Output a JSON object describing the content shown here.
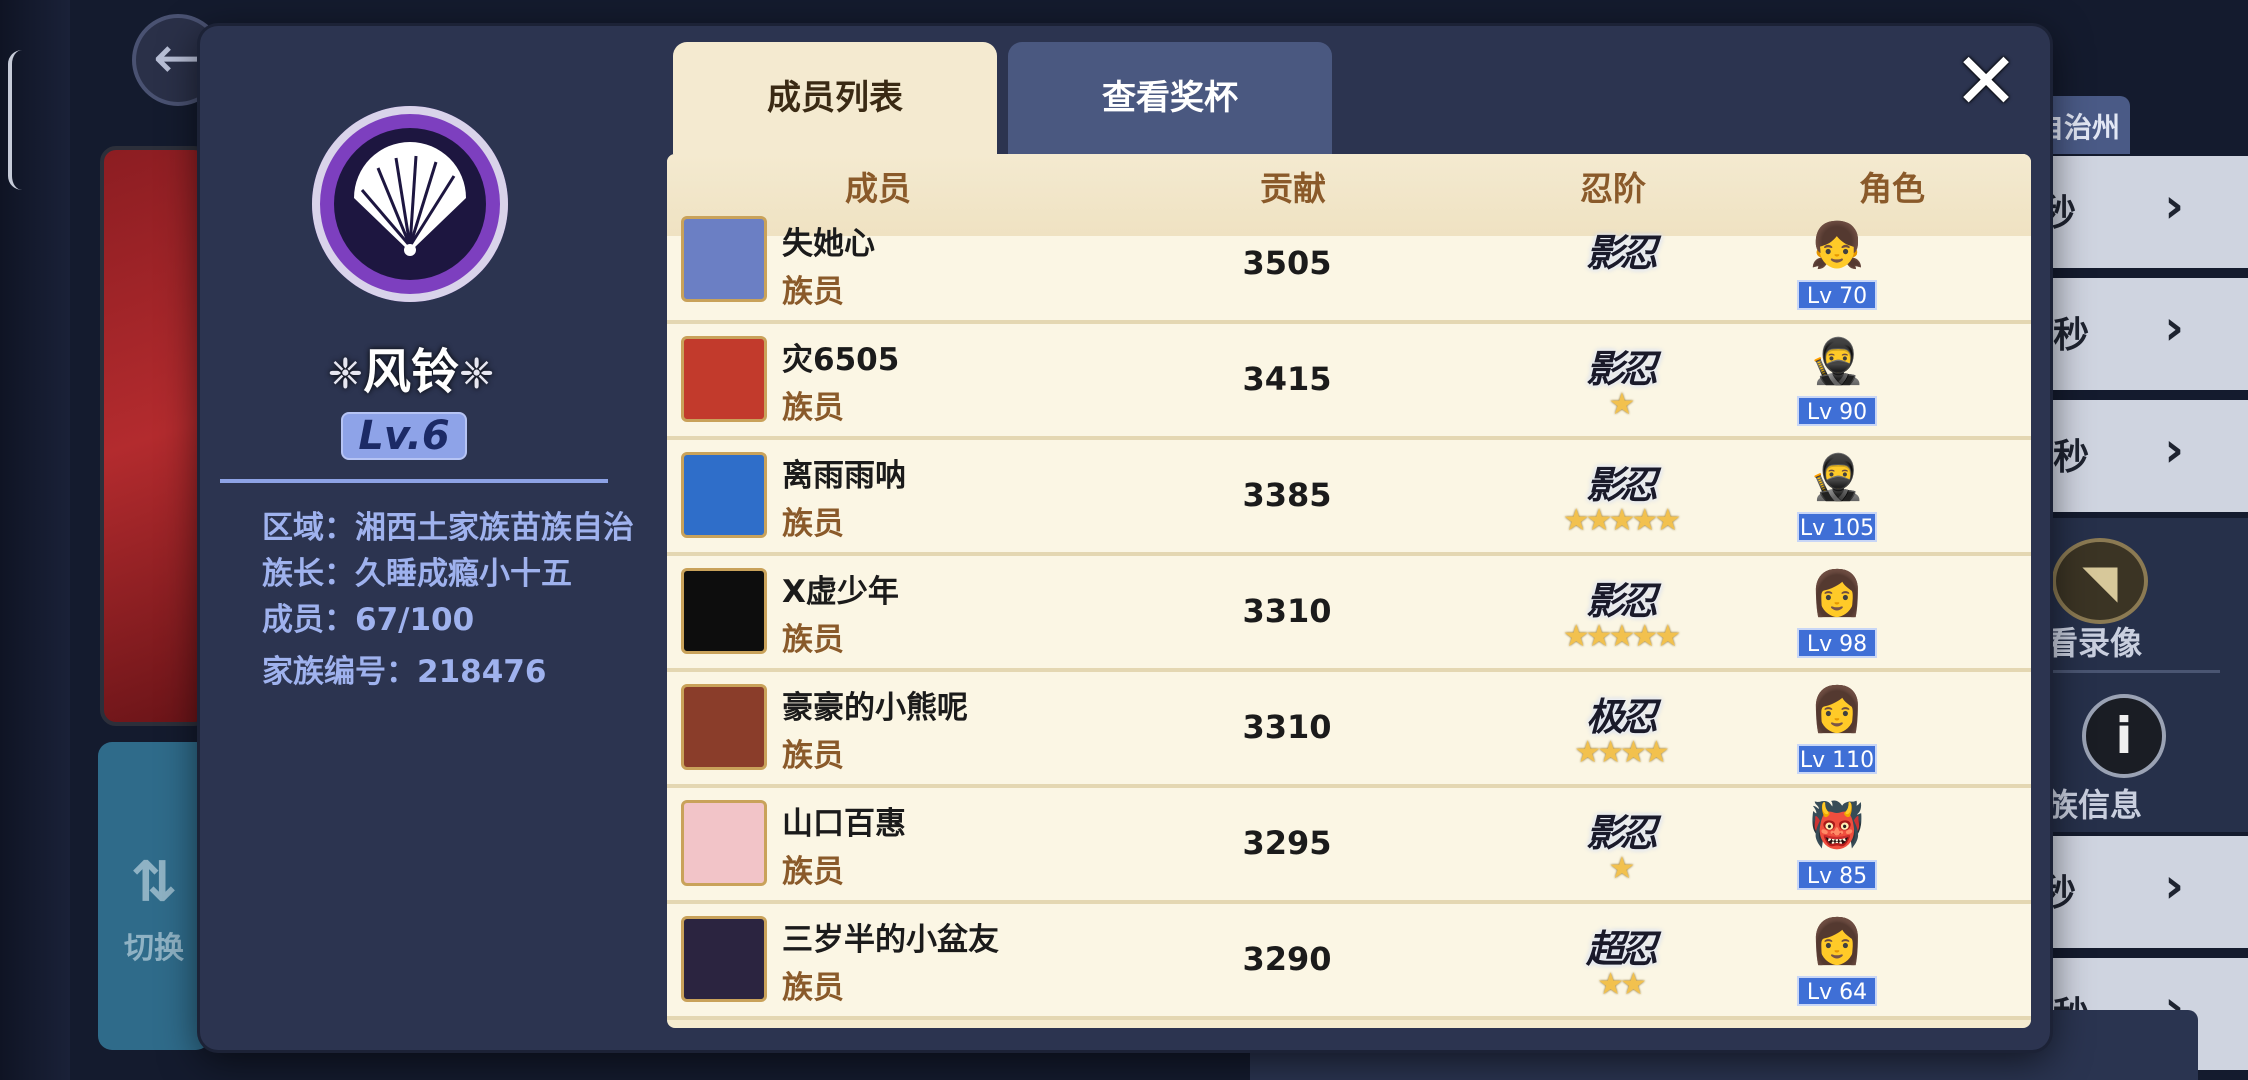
{
  "background": {
    "switch_label": "切换",
    "tag_label": "自治州",
    "rows": [
      "秒",
      "/秒",
      "/秒",
      "秒",
      "/秒"
    ],
    "watch_replay_label": "看录像",
    "clan_info_label": "族信息"
  },
  "clan": {
    "name": "风铃",
    "level": "Lv.6",
    "region_line": "区域：湘西土家族苗族自治",
    "leader_line": "族长：久睡成瘾小十五",
    "members_line": "成员：67/100",
    "id_line": "家族编号：218476",
    "emblem_icon": "folding-fan-icon"
  },
  "tabs": {
    "members": "成员列表",
    "trophy": "查看奖杯"
  },
  "close_symbol": "✕",
  "table": {
    "headers": {
      "member": "成员",
      "contribution": "贡献",
      "rank": "忍阶",
      "role": "角色"
    },
    "rows": [
      {
        "name": "失她心",
        "title": "族员",
        "contribution": "3505",
        "rank": "影忍",
        "stars": "",
        "level": "Lv 70",
        "avatar_color": "#6b7fc4",
        "role_face": "👧"
      },
      {
        "name": "灾6505",
        "title": "族员",
        "contribution": "3415",
        "rank": "影忍",
        "stars": "★",
        "level": "Lv 90",
        "avatar_color": "#c23a2c",
        "role_face": "🥷"
      },
      {
        "name": "离雨雨呐",
        "title": "族员",
        "contribution": "3385",
        "rank": "影忍",
        "stars": "★★★★★",
        "level": "Lv 105",
        "avatar_color": "#2f6ec9",
        "role_face": "🥷"
      },
      {
        "name": "X虚少年",
        "title": "族员",
        "contribution": "3310",
        "rank": "影忍",
        "stars": "★★★★★",
        "level": "Lv 98",
        "avatar_color": "#0d0d0d",
        "role_face": "👩"
      },
      {
        "name": "豪豪的小熊呢",
        "title": "族员",
        "contribution": "3310",
        "rank": "极忍",
        "stars": "★★★★",
        "level": "Lv 110",
        "avatar_color": "#8a3d2a",
        "role_face": "👩"
      },
      {
        "name": "山口百惠",
        "title": "族员",
        "contribution": "3295",
        "rank": "影忍",
        "stars": "★",
        "level": "Lv 85",
        "avatar_color": "#f2c4c8",
        "role_face": "👹"
      },
      {
        "name": "三岁半的小盆友",
        "title": "族员",
        "contribution": "3290",
        "rank": "超忍",
        "stars": "★★",
        "level": "Lv 64",
        "avatar_color": "#2b2440",
        "role_face": "👩"
      }
    ]
  }
}
